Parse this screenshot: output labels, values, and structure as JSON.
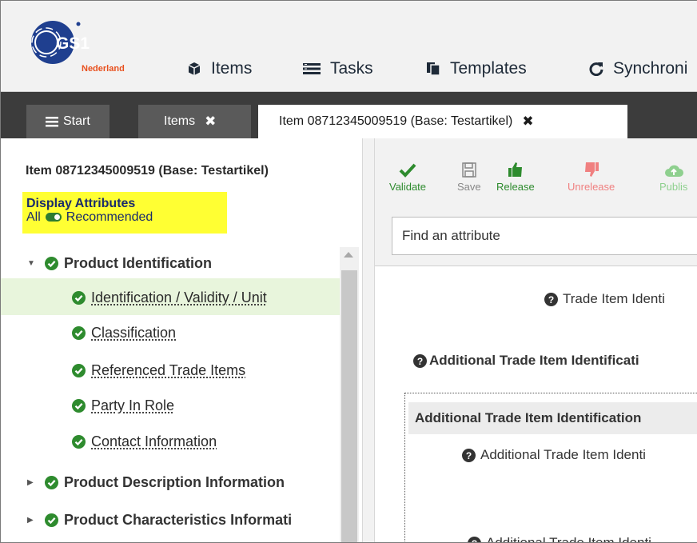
{
  "app": {
    "logo_text": "GS1",
    "logo_sub": "Nederland"
  },
  "nav": {
    "items": [
      {
        "label": "Items",
        "icon": "cube-icon"
      },
      {
        "label": "Tasks",
        "icon": "list-icon"
      },
      {
        "label": "Templates",
        "icon": "copy-icon"
      },
      {
        "label": "Synchroni",
        "icon": "refresh-icon"
      }
    ]
  },
  "tabs": [
    {
      "label": "Start",
      "icon": "menu-icon",
      "closable": false,
      "active": false
    },
    {
      "label": "Items",
      "closable": true,
      "active": false
    },
    {
      "label": "Item 08712345009519 (Base: Testartikel)",
      "closable": true,
      "active": true
    }
  ],
  "tab_close_symbol": "✖",
  "left": {
    "heading": "Item 08712345009519 (Base: Testartikel)",
    "display_attributes": {
      "title": "Display Attributes",
      "left_option": "All",
      "right_option": "Recommended",
      "toggle_color": "#2e7d32",
      "highlight_color": "#ffff33"
    },
    "tree": [
      {
        "label": "Product Identification",
        "expanded": true,
        "children": [
          {
            "label": "Identification / Validity / Unit",
            "selected": true
          },
          {
            "label": "Classification"
          },
          {
            "label": "Referenced Trade Items"
          },
          {
            "label": "Party In Role"
          },
          {
            "label": "Contact Information"
          }
        ]
      },
      {
        "label": "Product Description Information",
        "expanded": false
      },
      {
        "label": "Product Characteristics Informati",
        "expanded": false
      }
    ]
  },
  "toolbar": {
    "buttons": [
      {
        "label": "Validate",
        "icon": "check-icon",
        "color": "#2e8b2e"
      },
      {
        "label": "Save",
        "icon": "save-icon",
        "color": "#888888"
      },
      {
        "label": "Release",
        "icon": "thumbs-up-icon",
        "color": "#2e8b2e"
      },
      {
        "label": "Unrelease",
        "icon": "thumbs-down-icon",
        "color": "#f08080"
      },
      {
        "label": "Publis",
        "icon": "cloud-upload-icon",
        "color": "#8fd08f"
      }
    ],
    "search_placeholder": "Find an attribute"
  },
  "content": {
    "field1": "Trade Item Identi",
    "field2": "Additional Trade Item Identificati",
    "group_header": "Additional Trade Item Identification",
    "field3": "Additional Trade Item Identi",
    "field4": "Additional Trade Item Identi"
  },
  "colors": {
    "check_green": "#2e8b2e",
    "tab_bar": "#3c3c3c",
    "selected_row": "#e8f5dc"
  }
}
